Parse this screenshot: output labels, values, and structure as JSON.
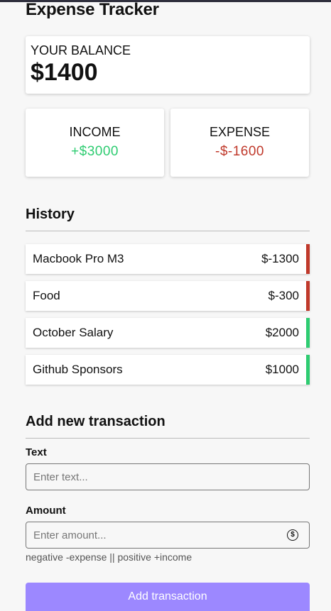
{
  "title": "Expense Tracker",
  "balance": {
    "label": "YOUR BALANCE",
    "value": "$1400"
  },
  "summary": {
    "income_label": "INCOME",
    "income_value": "+$3000",
    "expense_label": "EXPENSE",
    "expense_value": "-$-1600"
  },
  "history": {
    "title": "History",
    "items": [
      {
        "text": "Macbook Pro M3",
        "amount": "$-1300",
        "type": "minus"
      },
      {
        "text": "Food",
        "amount": "$-300",
        "type": "minus"
      },
      {
        "text": "October Salary",
        "amount": "$2000",
        "type": "plus"
      },
      {
        "text": "Github Sponsors",
        "amount": "$1000",
        "type": "plus"
      }
    ]
  },
  "form": {
    "title": "Add new transaction",
    "text_label": "Text",
    "text_placeholder": "Enter text...",
    "amount_label": "Amount",
    "amount_placeholder": "Enter amount...",
    "amount_icon": "dollar-circle-icon",
    "hint": "negative -expense || positive +income",
    "submit_label": "Add transaction"
  },
  "colors": {
    "income": "#2ecc71",
    "expense": "#c0392b",
    "button": "#9c88ff"
  }
}
